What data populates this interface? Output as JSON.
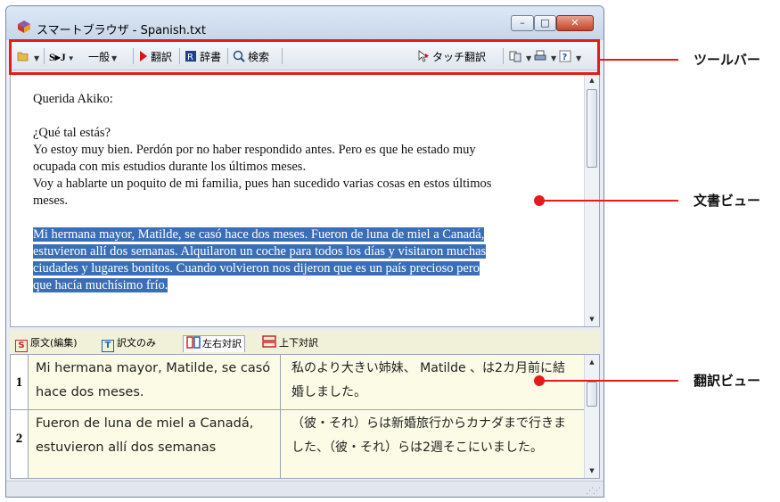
{
  "window": {
    "title": "スマートブラウザ - Spanish.txt",
    "controls": {
      "minimize": "–",
      "maximize": "□",
      "close": "✕"
    }
  },
  "toolbar": {
    "items": [
      {
        "label": "",
        "icon": "folder-open-icon"
      },
      {
        "label": "S▸J"
      },
      {
        "label": "一般"
      },
      {
        "label": "翻訳",
        "icon": "play-triangle-icon"
      },
      {
        "label": "辞書",
        "icon": "dictionary-icon"
      },
      {
        "label": "検索",
        "icon": "magnifier-icon"
      },
      {
        "label": "タッチ翻訳",
        "icon": "touch-pointer-icon"
      }
    ]
  },
  "document": {
    "lines": [
      "Querida Akiko:",
      "¿Qué tal estás?",
      "Yo estoy muy bien. Perdón por no haber respondido antes. Pero es que he estado muy",
      "ocupada con mis estudios durante los últimos meses.",
      "Voy a hablarte un poquito de mi familia, pues han sucedido varias cosas en estos últimos",
      "meses."
    ],
    "selected_lines": [
      "Mi hermana mayor, Matilde, se casó hace dos meses. Fueron de luna de miel a Canadá,",
      "estuvieron allí dos semanas. Alquilaron un coche para todos los días y visitaron muchas",
      "ciudades y lugares bonitos. Cuando volvieron nos dijeron que es un país precioso pero",
      "que hacía muchísimo frío."
    ]
  },
  "tabs": [
    {
      "icon_letter": "S",
      "label": "原文(編集)"
    },
    {
      "icon_letter": "T",
      "label": "訳文のみ"
    },
    {
      "icon_letter": "",
      "label": "左右対訳"
    },
    {
      "icon_letter": "",
      "label": "上下対訳"
    }
  ],
  "translation_rows": [
    {
      "num": "1",
      "source": "Mi hermana mayor, Matilde, se casó hace dos meses.",
      "target": "私のより大きい姉妹、 Matilde 、は2カ月前に結婚しました。"
    },
    {
      "num": "2",
      "source": "Fueron de luna de miel a Canadá, estuvieron allí dos semanas",
      "target": "（彼・それ）らは新婚旅行からカナダまで行きました、（彼・それ）らは2週そこにいました。"
    }
  ],
  "callouts": {
    "toolbar": "ツールバー",
    "document_view": "文書ビュー",
    "translation_view": "翻訳ビュー"
  },
  "colors": {
    "highlight": "#e51b1b",
    "selection": "#3a6fb7"
  }
}
